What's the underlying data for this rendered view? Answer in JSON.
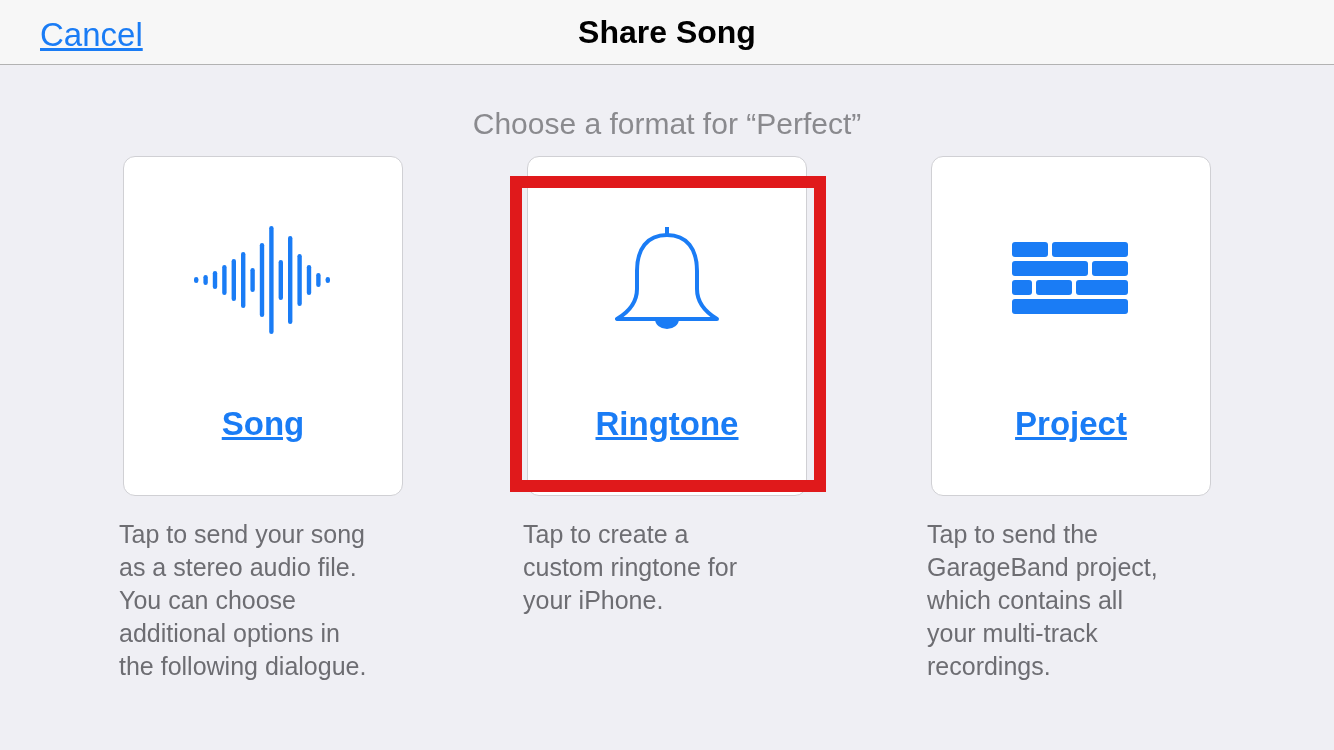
{
  "nav_bar": {
    "cancel": "Cancel",
    "title": "Share Song"
  },
  "prompt": "Choose a format for “Perfect”",
  "formats": [
    {
      "kind": "song",
      "label": "Song",
      "description": "Tap to send your song as a stereo audio file. You can choose additional options in the following dialogue.",
      "highlighted": false
    },
    {
      "kind": "ringtone",
      "label": "Ringtone",
      "description": "Tap to create a custom ringtone for your iPhone.",
      "highlighted": true
    },
    {
      "kind": "project",
      "label": "Project",
      "description": "Tap to send the GarageBand project, which contains all your multi-track recordings.",
      "highlighted": false
    }
  ]
}
